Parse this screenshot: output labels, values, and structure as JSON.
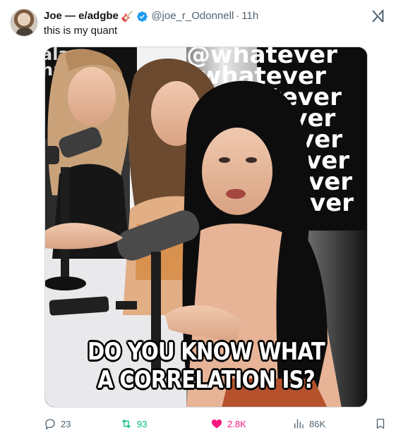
{
  "post": {
    "author_name": "Joe — e/adgbe",
    "author_emoji": "🎸",
    "handle": "@joe_r_Odonnell",
    "separator": "·",
    "time": "11h",
    "text": "this is my quant"
  },
  "media": {
    "caption_line1": "DO YOU KNOW WHAT",
    "caption_line2": "A CORRELATION IS?",
    "backdrop_words": [
      "@whatever",
      "whatever",
      "whatever",
      "tever",
      "ever",
      "ever",
      "ever",
      "ever"
    ]
  },
  "actions": {
    "replies": "23",
    "reposts": "93",
    "likes": "2.8K",
    "views": "86K"
  },
  "colors": {
    "verified": "#1d9bf0",
    "repost": "#00ba7c",
    "like": "#f91880",
    "secondary_text": "#536471"
  },
  "icons": {
    "verified": "verified-badge-icon",
    "grok": "grok-icon",
    "reply": "reply-icon",
    "repost": "repost-icon",
    "like": "heart-icon",
    "views": "views-chart-icon",
    "bookmark": "bookmark-icon"
  }
}
